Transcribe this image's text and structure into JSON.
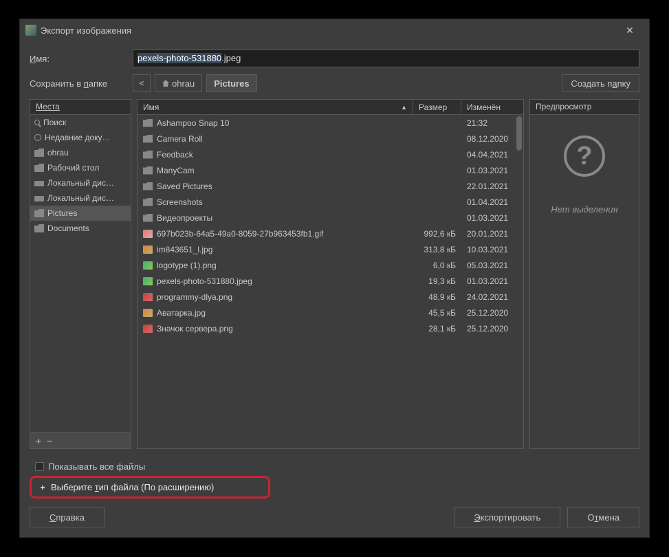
{
  "window": {
    "title": "Экспорт изображения"
  },
  "name_row": {
    "label": "Имя:",
    "value_sel": "pexels-photo-531880",
    "value_ext": ".jpeg"
  },
  "save_row": {
    "label": "Сохранить в папке",
    "crumb1": "ohrau",
    "crumb2": "Pictures",
    "create_btn": "Создать папку"
  },
  "places": {
    "header": "Места",
    "items": [
      {
        "label": "Поиск",
        "icon": "search"
      },
      {
        "label": "Недавние доку…",
        "icon": "clock"
      },
      {
        "label": "ohrau",
        "icon": "folder"
      },
      {
        "label": "Рабочий стол",
        "icon": "folder"
      },
      {
        "label": "Локальный дис…",
        "icon": "drive"
      },
      {
        "label": "Локальный дис…",
        "icon": "drive"
      },
      {
        "label": "Pictures",
        "icon": "folder",
        "selected": true
      },
      {
        "label": "Documents",
        "icon": "folder"
      }
    ]
  },
  "files": {
    "headers": {
      "name": "Имя",
      "size": "Размер",
      "modified": "Изменён"
    },
    "rows": [
      {
        "name": "Ashampoo Snap 10",
        "icon": "folder",
        "size": "",
        "mod": "21:32"
      },
      {
        "name": "Camera Roll",
        "icon": "folder",
        "size": "",
        "mod": "08.12.2020"
      },
      {
        "name": "Feedback",
        "icon": "folder",
        "size": "",
        "mod": "04.04.2021"
      },
      {
        "name": "ManyCam",
        "icon": "folder",
        "size": "",
        "mod": "01.03.2021"
      },
      {
        "name": "Saved Pictures",
        "icon": "folder",
        "size": "",
        "mod": "22.01.2021"
      },
      {
        "name": "Screenshots",
        "icon": "folder",
        "size": "",
        "mod": "01.04.2021"
      },
      {
        "name": "Видеопроекты",
        "icon": "folder",
        "size": "",
        "mod": "01.03.2021"
      },
      {
        "name": "697b023b-64a5-49a0-8059-27b963453fb1.gif",
        "icon": "gif",
        "size": "992,6 кБ",
        "mod": "20.01.2021"
      },
      {
        "name": "im843651_l.jpg",
        "icon": "img2",
        "size": "313,8 кБ",
        "mod": "10.03.2021"
      },
      {
        "name": "logotype (1).png",
        "icon": "img",
        "size": "6,0 кБ",
        "mod": "05.03.2021"
      },
      {
        "name": "pexels-photo-531880.jpeg",
        "icon": "img",
        "size": "19,3 кБ",
        "mod": "01.03.2021"
      },
      {
        "name": "programmy-dlya.png",
        "icon": "png",
        "size": "48,9 кБ",
        "mod": "24.02.2021"
      },
      {
        "name": "Аватарка.jpg",
        "icon": "img2",
        "size": "45,5 кБ",
        "mod": "25.12.2020"
      },
      {
        "name": "Значок сервера.png",
        "icon": "png",
        "size": "28,1 кБ",
        "mod": "25.12.2020"
      }
    ]
  },
  "preview": {
    "header": "Предпросмотр",
    "empty": "Нет выделения"
  },
  "bottom": {
    "show_all": "Показывать все файлы",
    "file_type": "Выберите тип файла (По расширению)"
  },
  "buttons": {
    "help": "Справка",
    "export": "Экспортировать",
    "cancel": "Отмена"
  }
}
